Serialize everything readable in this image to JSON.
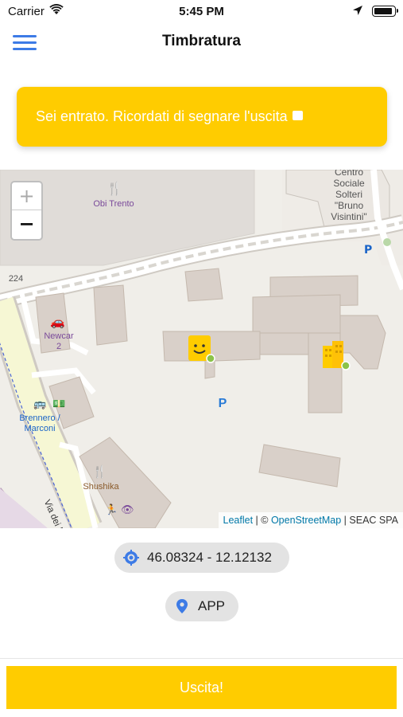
{
  "status_bar": {
    "carrier": "Carrier",
    "time": "5:45 PM"
  },
  "nav": {
    "title": "Timbratura"
  },
  "banner": {
    "message": "Sei entrato. Ricordati di segnare l'uscita",
    "color": "#ffcc00"
  },
  "map": {
    "zoom_in_label": "+",
    "zoom_out_label": "−",
    "labels": {
      "obi": "Obi Trento",
      "centro": "Centro\nSociale\nSolteri\n\"Bruno\nVisintini\"",
      "road_224": "224",
      "newcar": "Newcar\n2",
      "brennero": "Brennero /\nMarconi",
      "shushika": "Shushika",
      "parking": "P",
      "via": "Via dei Bren"
    },
    "attribution": {
      "leaflet": "Leaflet",
      "separator": " | © ",
      "osm": "OpenStreetMap",
      "suffix": " | SEAC SPA"
    }
  },
  "location": {
    "coordinates": "46.08324 - 12.12132",
    "source": "APP"
  },
  "actions": {
    "exit_label": "Uscita!"
  },
  "colors": {
    "accent": "#ffcc00",
    "menu": "#3d7be6",
    "link": "#0078a8"
  }
}
